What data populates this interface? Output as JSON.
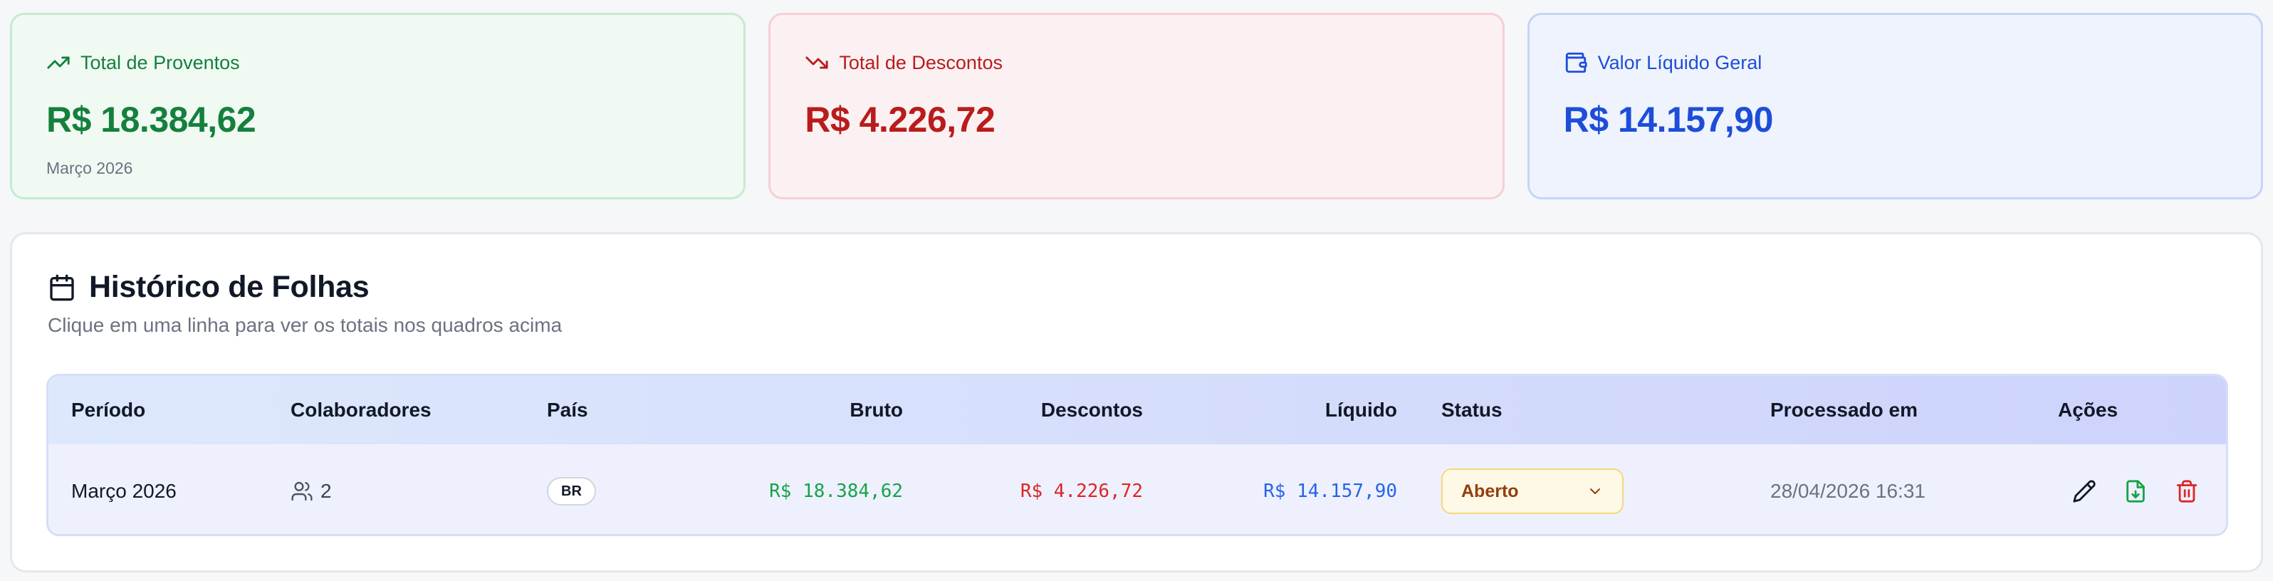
{
  "summary": {
    "proventos": {
      "title": "Total de Proventos",
      "value": "R$ 18.384,62",
      "sub": "Março 2026",
      "icon": "trending-up-icon",
      "color": "#15803d"
    },
    "descontos": {
      "title": "Total de Descontos",
      "value": "R$ 4.226,72",
      "icon": "trending-down-icon",
      "color": "#b91c1c"
    },
    "liquido": {
      "title": "Valor Líquido Geral",
      "value": "R$ 14.157,90",
      "icon": "wallet-icon",
      "color": "#1d4ed8"
    }
  },
  "history": {
    "title": "Histórico de Folhas",
    "subtitle": "Clique em uma linha para ver os totais nos quadros acima",
    "icon": "calendar-icon",
    "columns": {
      "periodo": "Período",
      "colaboradores": "Colaboradores",
      "pais": "País",
      "bruto": "Bruto",
      "descontos": "Descontos",
      "liquido": "Líquido",
      "status": "Status",
      "processado": "Processado em",
      "acoes": "Ações"
    },
    "rows": [
      {
        "periodo": "Março 2026",
        "colaboradores": "2",
        "pais": "BR",
        "bruto": "R$ 18.384,62",
        "descontos": "R$ 4.226,72",
        "liquido": "R$ 14.157,90",
        "status": "Aberto",
        "processado": "28/04/2026 16:31",
        "actions": [
          "edit-icon",
          "download-file-icon",
          "trash-icon"
        ]
      }
    ]
  },
  "colors": {
    "green": "#16a34a",
    "red": "#dc2626",
    "blue": "#2563eb",
    "status_bg": "#fef9e7",
    "status_text": "#92400e"
  }
}
